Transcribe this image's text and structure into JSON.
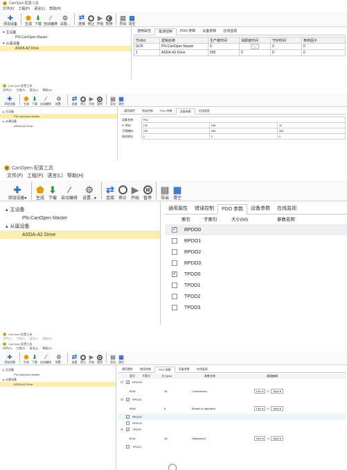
{
  "app_title": "CanOpen 配置工具",
  "menu": [
    "文件(F)",
    "工程(P)",
    "语言(L)",
    "帮助(H)"
  ],
  "toolbar": {
    "add_device": "添加设备",
    "generate": "生成",
    "download": "下载",
    "auto_map": "自动编排",
    "settings": "设置...",
    "connect": "连接",
    "stop": "停止",
    "start": "开始",
    "pause": "暂停",
    "export": "导出",
    "clear": "清空",
    "add_device_arrow": "▾",
    "settings_arrow": "▾"
  },
  "tree": {
    "master_group": "主设备",
    "master_item": "PN-CanOpen Master",
    "slave_group": "从属设备",
    "slave_item": "ASDA-A2 Drive"
  },
  "tabs": [
    "通用属性",
    "错误控制",
    "PDO 参数",
    "设备参数",
    "在线监视"
  ],
  "panel1": {
    "active_tab": 1,
    "headers": [
      "节点Id",
      "逻辑名称",
      "生产者时间",
      "消费者时间",
      "守护时间",
      "寿命因子"
    ],
    "rows": [
      [
        "0x7F",
        "PN-CanOpen Master",
        "0",
        "",
        "0",
        "0"
      ],
      [
        "1",
        "ASDA-A2 Drive",
        "500",
        "0",
        "0",
        "0"
      ]
    ],
    "ellipsis": "..."
  },
  "panel2": {
    "active_tab": 3,
    "fields": [
      {
        "label": "设备名称:",
        "values": [
          "PN1"
        ]
      },
      {
        "label": "IP 地址:",
        "values": [
          "192",
          "168",
          "20"
        ]
      },
      {
        "label": "子网掩码:",
        "values": [
          "255",
          "255",
          "255"
        ]
      },
      {
        "label": "网关地址:",
        "values": [
          "0",
          "0",
          "0"
        ]
      }
    ]
  },
  "panel3": {
    "active_tab": 2,
    "headers": [
      "索引",
      "子索引",
      "大小(bit)",
      "参数名称"
    ],
    "items": [
      {
        "label": "RPDO0",
        "checked": true,
        "selected": true
      },
      {
        "label": "RPDO1",
        "checked": false
      },
      {
        "label": "RPDO2",
        "checked": false
      },
      {
        "label": "RPDO3",
        "checked": false
      },
      {
        "label": "TPDO0",
        "checked": true
      },
      {
        "label": "TPDO1",
        "checked": false
      },
      {
        "label": "TPDO2",
        "checked": false
      },
      {
        "label": "TPDO3",
        "checked": false
      }
    ]
  },
  "panel4": {
    "active_tab": 2,
    "headers": [
      "索引",
      "子索引",
      "大小(bit)",
      "参数名称",
      "通道编辑"
    ],
    "rows": [
      {
        "kind": "group",
        "label": "RPDO0",
        "checked": true,
        "toggle": "⊟"
      },
      {
        "kind": "param",
        "index": "6040",
        "size": "16",
        "name": "Controlword",
        "fmt": "Dec",
        "val": "0",
        "unit": "Byte"
      },
      {
        "kind": "group",
        "label": "RPDO1",
        "checked": true,
        "toggle": "⊟"
      },
      {
        "kind": "param",
        "index": "6060",
        "size": "8",
        "name": "Modes of operation",
        "fmt": "Dec",
        "val": "0",
        "unit": "Byte"
      },
      {
        "kind": "group",
        "label": "RPDO2",
        "checked": true,
        "toggle": ""
      },
      {
        "kind": "group",
        "label": "RPDO3",
        "checked": false,
        "toggle": ""
      },
      {
        "kind": "group",
        "label": "TPDO0",
        "checked": true,
        "toggle": "⊟"
      },
      {
        "kind": "param",
        "index": "6041",
        "size": "16",
        "name": "Statusword",
        "fmt": "Dec",
        "val": "0",
        "unit": "Byte"
      },
      {
        "kind": "group",
        "label": "TPDO1",
        "checked": false,
        "toggle": ""
      }
    ]
  }
}
